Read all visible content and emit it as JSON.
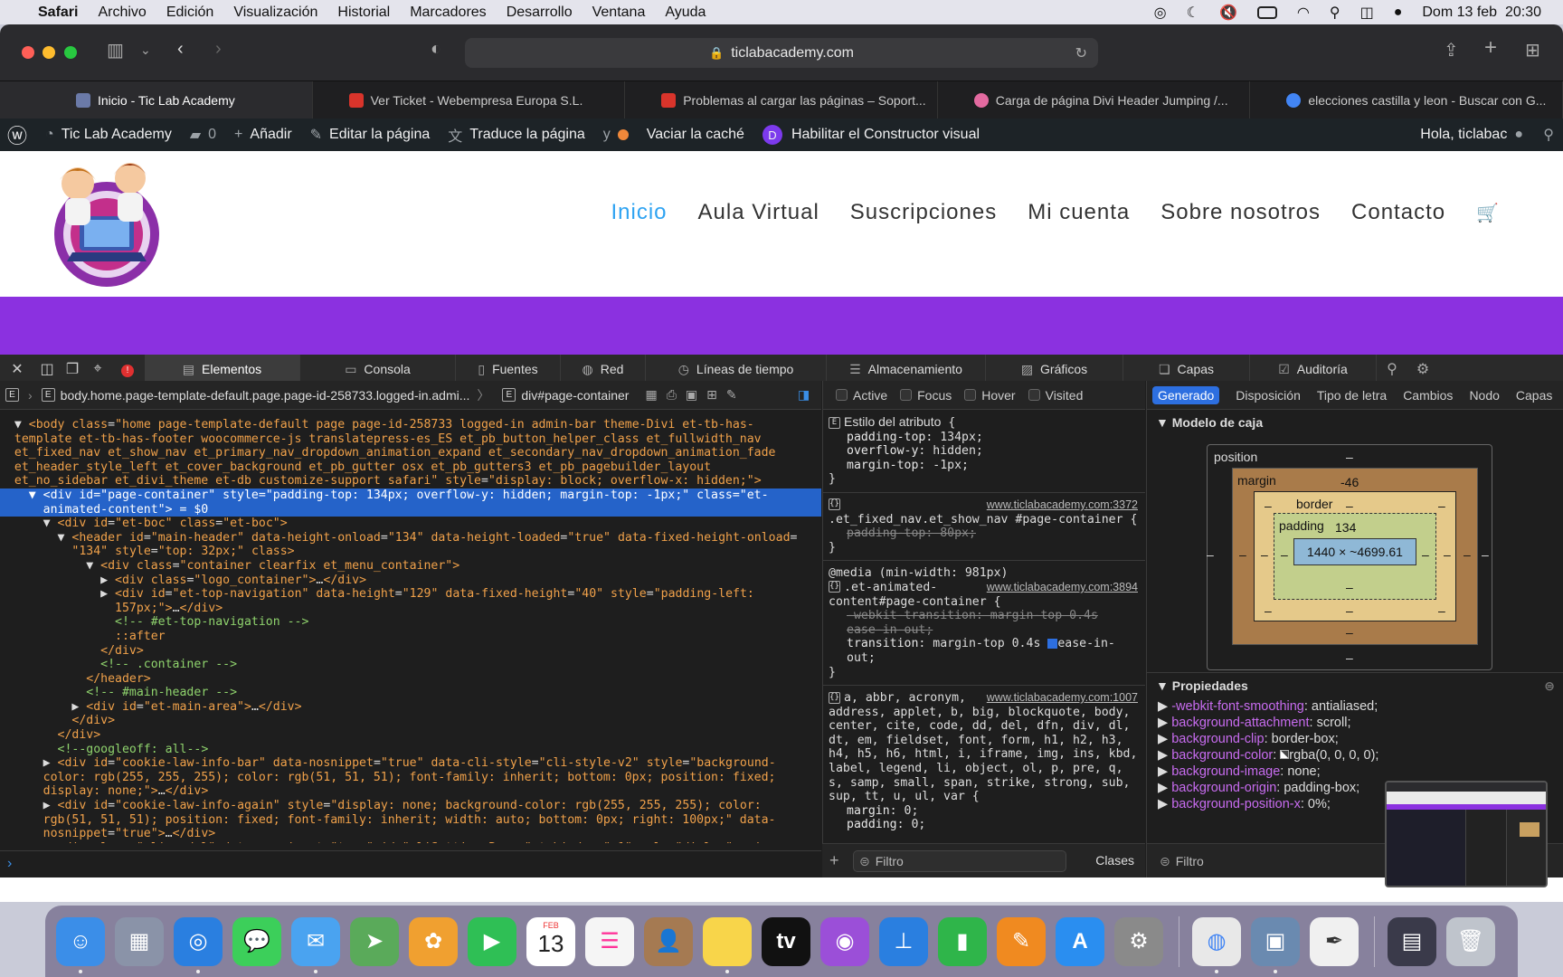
{
  "menubar": {
    "app": "Safari",
    "items": [
      "Archivo",
      "Edición",
      "Visualización",
      "Historial",
      "Marcadores",
      "Desarrollo",
      "Ventana",
      "Ayuda"
    ],
    "clock": "Dom 13 feb  20:30"
  },
  "browser": {
    "url": "ticlabacademy.com",
    "tabs": [
      {
        "title": "Inicio - Tic Lab Academy",
        "color": "#6b7aa8"
      },
      {
        "title": "Ver Ticket - Webempresa Europa S.L.",
        "color": "#d9342b"
      },
      {
        "title": "Problemas al cargar las páginas – Soport...",
        "color": "#d9342b"
      },
      {
        "title": "Carga de página Divi Header Jumping /...",
        "color": "#e36aa0"
      },
      {
        "title": "elecciones castilla y leon - Buscar con G...",
        "color": "#4285f4"
      }
    ]
  },
  "adminbar": {
    "site": "Tic Lab Academy",
    "comments": "0",
    "add": "Añadir",
    "edit": "Editar la página",
    "translate": "Traduce la página",
    "cache": "Vaciar la caché",
    "builder": "Habilitar el Constructor visual",
    "greeting": "Hola, ticlabac"
  },
  "site": {
    "nav": [
      "Inicio",
      "Aula Virtual",
      "Suscripciones",
      "Mi cuenta",
      "Sobre nosotros",
      "Contacto"
    ]
  },
  "devtools": {
    "tabs": [
      "Elementos",
      "Consola",
      "Fuentes",
      "Red",
      "Líneas de tiempo",
      "Almacenamiento",
      "Gráficos",
      "Capas",
      "Auditoría"
    ],
    "breadcrumb": [
      "body.home.page-template-default.page.page-id-258733.logged-in.admi...",
      "div#page-container"
    ],
    "pseudo": [
      "Active",
      "Focus",
      "Hover",
      "Visited"
    ],
    "sidetabs": [
      "Generado",
      "Disposición",
      "Tipo de letra",
      "Cambios",
      "Nodo",
      "Capas"
    ],
    "boxmodel": {
      "title": "Modelo de caja",
      "position_label": "position",
      "margin_label": "margin",
      "margin_top": "-46",
      "border_label": "border",
      "padding_label": "padding",
      "padding_top": "134",
      "content": "1440 × ~4699.61",
      "dash": "–"
    },
    "properties_title": "Propiedades",
    "properties": [
      [
        "-webkit-font-smoothing",
        "antialiased"
      ],
      [
        "background-attachment",
        "scroll"
      ],
      [
        "background-clip",
        "border-box"
      ],
      [
        "background-color",
        "rgba(0, 0, 0, 0)"
      ],
      [
        "background-image",
        "none"
      ],
      [
        "background-origin",
        "padding-box"
      ],
      [
        "background-position-x",
        "0%"
      ]
    ],
    "filter_placeholder": "Filtro",
    "classes_label": "Clases",
    "rule1_head": "Estilo del atributo",
    "rule2_src": "www.ticlabacademy.com:3372",
    "rule2_sel": ".et_fixed_nav.et_show_nav #page-container {",
    "rule3_media": "@media (min-width: 981px)",
    "rule3_src": "www.ticlabacademy.com:3894",
    "rule4_src": "www.ticlabacademy.com:1007"
  },
  "dock": [
    {
      "name": "finder",
      "color": "#3b8ee8",
      "label": "☺"
    },
    {
      "name": "launchpad",
      "color": "#8a93a8",
      "label": "▦"
    },
    {
      "name": "safari",
      "color": "#2a7fe0",
      "label": "◎"
    },
    {
      "name": "messages",
      "color": "#3ccf5a",
      "label": "💬"
    },
    {
      "name": "mail",
      "color": "#4aa3f0",
      "label": "✉"
    },
    {
      "name": "maps",
      "color": "#5aaa5a",
      "label": "➤"
    },
    {
      "name": "photos",
      "color": "#f0a030",
      "label": "✿"
    },
    {
      "name": "facetime",
      "color": "#2fbf55",
      "label": "▶"
    },
    {
      "name": "calendar",
      "color": "#ffffff",
      "label": "13"
    },
    {
      "name": "reminders",
      "color": "#f5f5f5",
      "label": "☰"
    },
    {
      "name": "contacts",
      "color": "#a57a52",
      "label": "👤"
    },
    {
      "name": "notes",
      "color": "#f8d54a",
      "label": ""
    },
    {
      "name": "tv",
      "color": "#111111",
      "label": "tv"
    },
    {
      "name": "podcasts",
      "color": "#9b4fd8",
      "label": "◉"
    },
    {
      "name": "keynote",
      "color": "#2a7fe0",
      "label": "⊥"
    },
    {
      "name": "numbers",
      "color": "#2fb54a",
      "label": "▮"
    },
    {
      "name": "pages",
      "color": "#f08a20",
      "label": "✎"
    },
    {
      "name": "appstore",
      "color": "#2a8ef0",
      "label": "A"
    },
    {
      "name": "settings",
      "color": "#8a8a8a",
      "label": "⚙"
    },
    {
      "name": "chrome",
      "color": "#e8e8e8",
      "label": "◍"
    },
    {
      "name": "preview",
      "color": "#6a8ab0",
      "label": "▣"
    },
    {
      "name": "textedit",
      "color": "#f0f0f0",
      "label": "✒"
    },
    {
      "name": "window",
      "color": "#3a3a4a",
      "label": "▤"
    },
    {
      "name": "trash",
      "color": "#bfc4cc",
      "label": "🗑"
    }
  ]
}
